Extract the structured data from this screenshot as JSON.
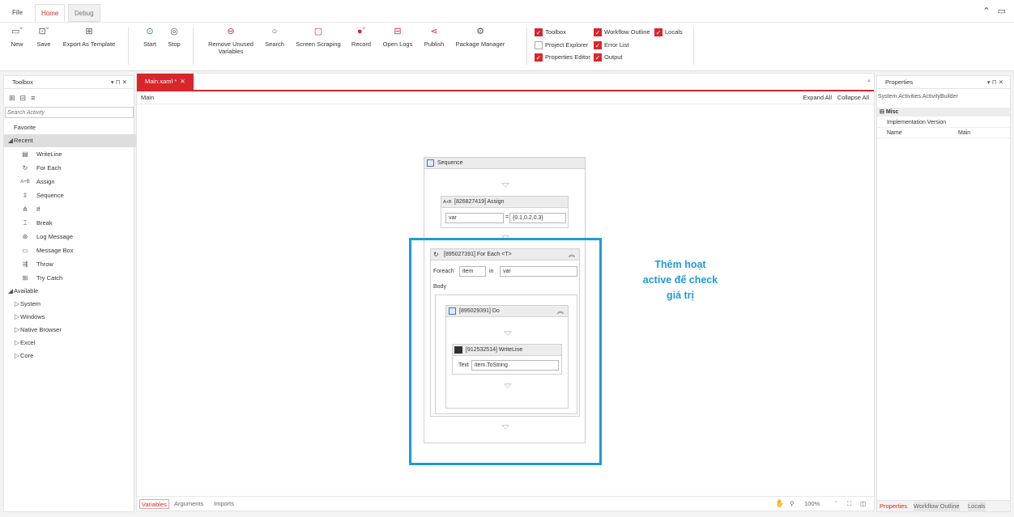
{
  "menu_tabs": [
    "File",
    "Home",
    "Debug"
  ],
  "ribbon": {
    "buttons": {
      "new": "New",
      "save": "Save",
      "export_template": "Export As Template",
      "start": "Start",
      "stop": "Stop",
      "remove_unused_1": "Remove Unused",
      "remove_unused_2": "Variables",
      "search": "Search",
      "screen_scraping": "Screen Scraping",
      "record": "Record",
      "open_logs": "Open Logs",
      "publish": "Publish",
      "package_manager": "Package Manager"
    },
    "checkboxes": {
      "toolbox": {
        "label": "Toolbox",
        "checked": true
      },
      "workflow_outline": {
        "label": "Workflow Outline",
        "checked": true
      },
      "locals": {
        "label": "Locals",
        "checked": true
      },
      "project_explorer": {
        "label": "Project Explorer",
        "checked": false
      },
      "error_list": {
        "label": "Error List",
        "checked": true
      },
      "properties_editor": {
        "label": "Properties Editor",
        "checked": true
      },
      "output": {
        "label": "Output",
        "checked": true
      }
    }
  },
  "toolbox": {
    "title": "Toolbox",
    "controls": "▾ ⊓ ✕",
    "search_placeholder": "Search Activity",
    "favorite": "Favorite",
    "recent": "Recent",
    "recent_items": [
      "WriteLine",
      "For Each",
      "Assign",
      "Sequence",
      "If",
      "Break",
      "Log Message",
      "Message Box",
      "Throw",
      "Try Catch"
    ],
    "available": "Available",
    "available_items": [
      "System",
      "Windows",
      "Native Browser",
      "Excel",
      "Core"
    ]
  },
  "designer": {
    "tab_label": "Main.xaml *",
    "breadcrumb": "Main",
    "expand_all": "Expand All",
    "collapse_all": "Collapse All",
    "sequence_title": "Sequence",
    "assign": {
      "title": "[826827419] Assign",
      "target": "var",
      "value": "{0.1,0.2,0.3}"
    },
    "foreach": {
      "title": "[895027391] For Each <T>",
      "foreach_label": "Foreach",
      "item": "item",
      "in_label": "in",
      "collection": "var",
      "body_label": "Body"
    },
    "do": {
      "title": "[895029391] Do"
    },
    "writeline": {
      "title": "[912532514] WriteLine",
      "text_label": "Text",
      "text_value": "item.ToString"
    },
    "annotation": [
      "Thêm hoạt",
      "active để check",
      "giá trị"
    ]
  },
  "bottom_tabs": [
    "Variables",
    "Arguments",
    "Imports"
  ],
  "zoom": "100%",
  "properties": {
    "title": "Properties",
    "controls": "▾ ⊓ ✕",
    "type": "System.Activities.ActivityBuilder",
    "category": "Misc",
    "rows": [
      {
        "name": "Implementation Version",
        "value": ""
      },
      {
        "name": "Name",
        "value": "Main"
      }
    ],
    "tabs": [
      "Properties",
      "Workflow Outline",
      "Locals"
    ]
  },
  "colors": {
    "accent": "#d9262c",
    "highlight": "#1f9ad6"
  }
}
